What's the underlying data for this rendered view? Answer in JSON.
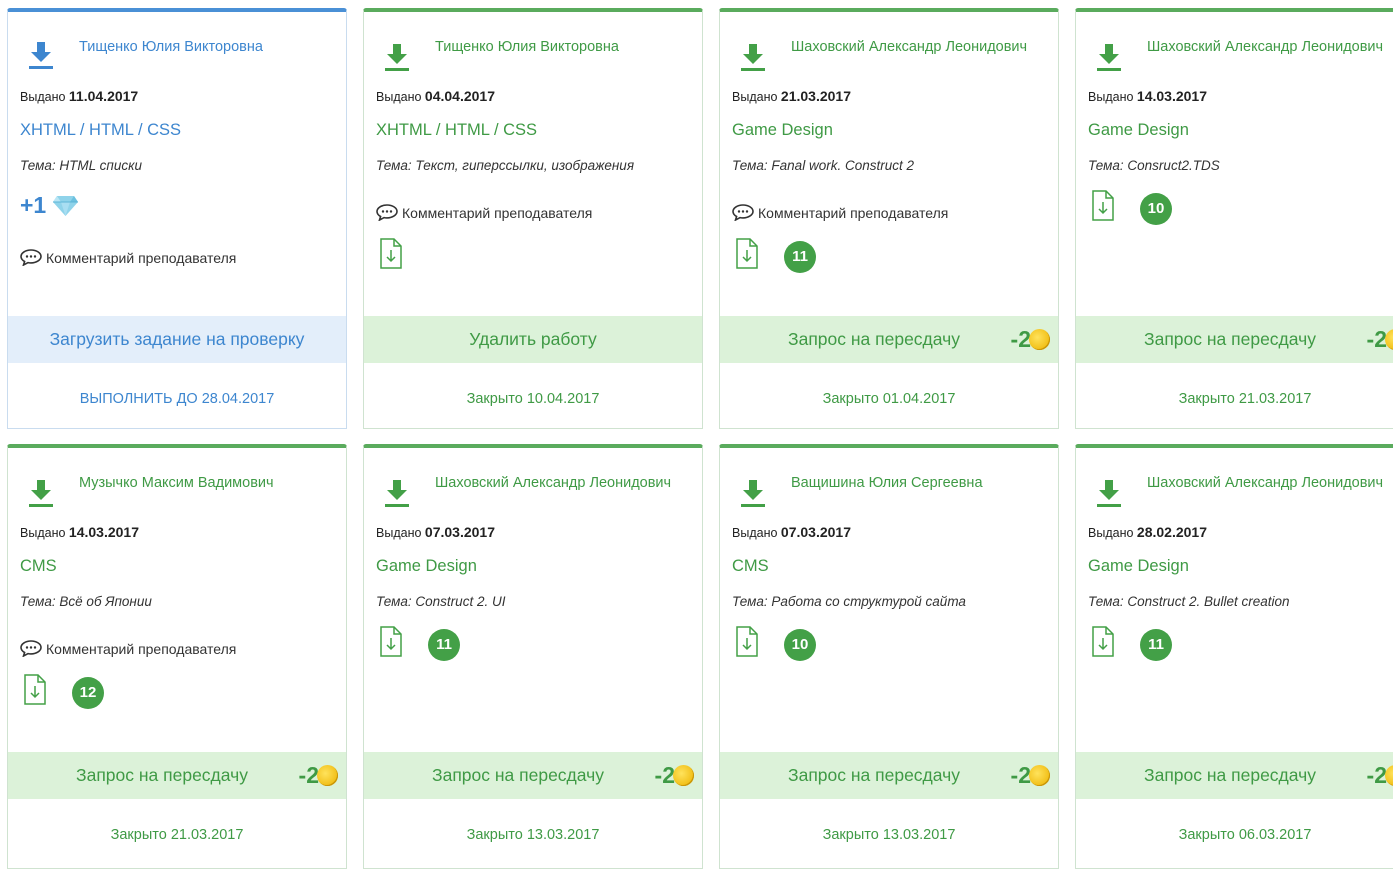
{
  "issued_label": "Выдано",
  "comment_label": "Комментарий преподавателя",
  "colors": {
    "green": "#3f9a45",
    "blue": "#3d86cf",
    "grade_bg": "#43a047",
    "action_green_bg": "#dcf2d9",
    "action_blue_bg": "#e3eefa"
  },
  "cards": [
    {
      "author": "Тищенко Юлия Викторовна",
      "issued_date": "11.04.2017",
      "subject": "XHTML / HTML / CSS",
      "theme": "Тема: HTML списки",
      "bonus": "+1",
      "bonus_icon": "diamond-icon",
      "action": "Загрузить задание на проверку",
      "footer": "ВЫПОЛНИТЬ ДО 28.04.2017"
    },
    {
      "author": "Тищенко Юлия Викторовна",
      "issued_date": "04.04.2017",
      "subject": "XHTML / HTML / CSS",
      "theme": "Тема: Текст, гиперссылки, изображения",
      "action": "Удалить работу",
      "footer": "Закрыто 10.04.2017"
    },
    {
      "author": "Шаховский Александр Леонидович",
      "issued_date": "21.03.2017",
      "subject": "Game Design",
      "theme": "Тема: Fanal work. Construct 2",
      "grade": "11",
      "action": "Запрос на пересдачу",
      "penalty": "-2",
      "footer": "Закрыто 01.04.2017"
    },
    {
      "author": "Шаховский Александр Леонидович",
      "issued_date": "14.03.2017",
      "subject": "Game Design",
      "theme": "Тема: Consruct2.TDS",
      "grade": "10",
      "action": "Запрос на пересдачу",
      "penalty": "-2",
      "footer": "Закрыто 21.03.2017"
    },
    {
      "author": "Музычко Максим Вадимович",
      "issued_date": "14.03.2017",
      "subject": "CMS",
      "theme": "Тема: Всё об Японии",
      "grade": "12",
      "action": "Запрос на пересдачу",
      "penalty": "-2",
      "footer": "Закрыто 21.03.2017"
    },
    {
      "author": "Шаховский Александр Леонидович",
      "issued_date": "07.03.2017",
      "subject": "Game Design",
      "theme": "Тема: Construct 2. UI",
      "grade": "11",
      "action": "Запрос на пересдачу",
      "penalty": "-2",
      "footer": "Закрыто 13.03.2017"
    },
    {
      "author": "Ващишина Юлия Сергеевна",
      "issued_date": "07.03.2017",
      "subject": "CMS",
      "theme": "Тема: Работа со структурой сайта",
      "grade": "10",
      "action": "Запрос на пересдачу",
      "penalty": "-2",
      "footer": "Закрыто 13.03.2017"
    },
    {
      "author": "Шаховский Александр Леонидович",
      "issued_date": "28.02.2017",
      "subject": "Game Design",
      "theme": "Тема: Construct 2. Bullet creation",
      "grade": "11",
      "action": "Запрос на пересдачу",
      "penalty": "-2",
      "footer": "Закрыто 06.03.2017"
    }
  ]
}
